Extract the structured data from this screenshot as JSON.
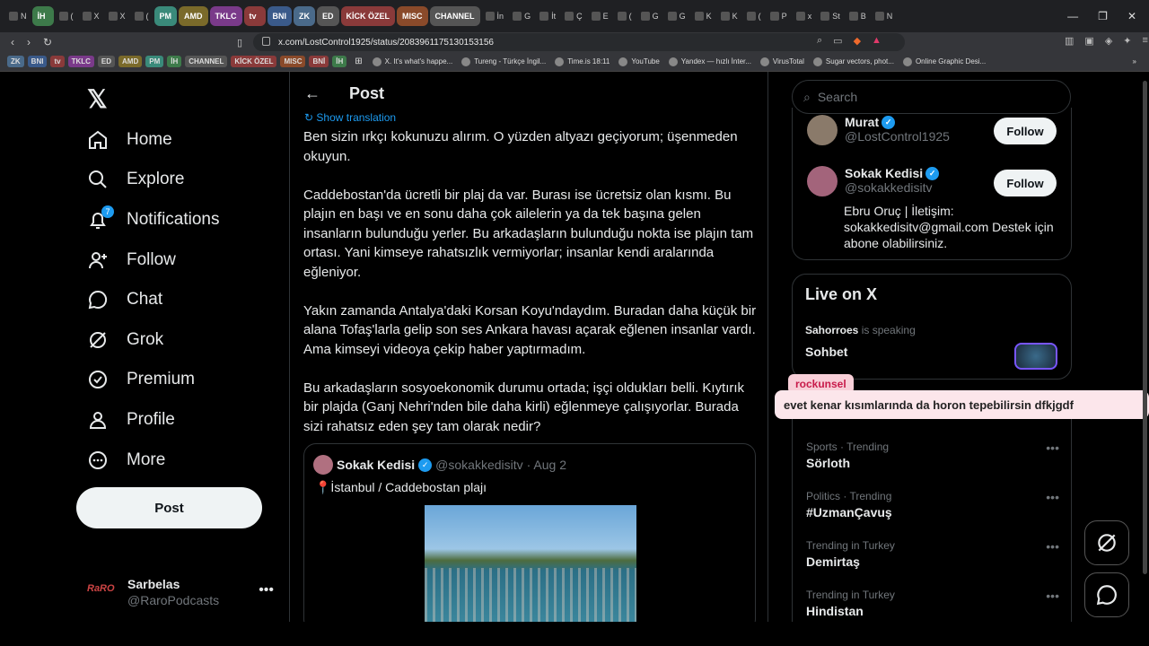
{
  "browser": {
    "tabs": [
      "N",
      "İH",
      "(",
      "X",
      "X",
      "(",
      "PM",
      "AMD",
      "TKLC",
      "tv",
      "BNI",
      "ZK",
      "ED",
      "KİCK ÖZEL",
      "MISC",
      "CHANNEL",
      "İn",
      "G",
      "İt",
      "Ç",
      "E",
      "(",
      "G",
      "G",
      "K",
      "K",
      "(",
      "P",
      "x",
      "St",
      "B",
      "N"
    ],
    "url": "x.com/LostControl1925/status/2083961175130153156",
    "bookmarks": {
      "chips": [
        "ZK",
        "BNI",
        "tv",
        "TKLC",
        "ED",
        "AMD",
        "PM",
        "İH",
        "CHANNEL",
        "KİCK ÖZEL",
        "MISC",
        "BNİ",
        "İH"
      ],
      "links": [
        "X. It's what's happe...",
        "Tureng - Türkçe İngil...",
        "Time.is 18:11",
        "YouTube",
        "Yandex — hızlı İnter...",
        "VirusTotal",
        "Sugar vectors, phot...",
        "Online Graphic Desi..."
      ]
    }
  },
  "nav": {
    "home": "Home",
    "explore": "Explore",
    "notifications": "Notifications",
    "notif_count": "7",
    "follow": "Follow",
    "chat": "Chat",
    "grok": "Grok",
    "premium": "Premium",
    "profile": "Profile",
    "more": "More",
    "post": "Post"
  },
  "me": {
    "name": "Sarbelas",
    "handle": "@RaroPodcasts",
    "avatar_text": "RaRO"
  },
  "main": {
    "title": "Post",
    "show_translation": "Show translation",
    "paragraphs": [
      "Ben sizin ırkçı kokunuzu alırım. O yüzden altyazı geçiyorum; üşenmeden okuyun.",
      "Caddebostan'da ücretli bir plaj da var. Burası ise ücretsiz olan kısmı. Bu plajın en başı ve en sonu daha çok ailelerin ya da tek başına gelen insanların bulunduğu yerler. Bu arkadaşların bulunduğu nokta ise plajın tam ortası. Yani kimseye rahatsızlık vermiyorlar; insanlar kendi aralarında eğleniyor.",
      "Yakın zamanda Antalya'daki Korsan Koyu'ndaydım. Buradan daha küçük bir alana Tofaş'larla gelip son ses Ankara havası açarak eğlenen insanlar vardı. Ama kimseyi videoya çekip haber yaptırmadım.",
      "Bu arkadaşların sosyoekonomik durumu ortada; işçi oldukları belli. Kıytırık bir plajda (Ganj Nehri'nden bile daha kirli) eğlenmeye çalışıyorlar. Burada sizi rahatsız eden şey tam olarak nedir?"
    ],
    "quote": {
      "name": "Sokak Kedisi",
      "handle": "@sokakkedisitv",
      "date": "· Aug 2",
      "text": "📍İstanbul / Caddebostan plajı"
    }
  },
  "sidebar": {
    "search_placeholder": "Search",
    "accounts": [
      {
        "name": "Murat",
        "handle": "@LostControl1925",
        "button": "Follow"
      },
      {
        "name": "Sokak Kedisi",
        "handle": "@sokakkedisitv",
        "button": "Follow",
        "bio": "Ebru Oruç | İletişim: sokakkedisitv@gmail.com Destek için abone olabilirsiniz."
      }
    ],
    "live": {
      "title": "Live on X",
      "speaker": "Sahorroes",
      "speaking": "is speaking",
      "room": "Sohbet"
    },
    "trends": [
      {
        "cat": "Sports · Trending",
        "title": "Sörloth"
      },
      {
        "cat": "Politics · Trending",
        "title": "#UzmanÇavuş"
      },
      {
        "cat": "Trending in Turkey",
        "title": "Demirtaş"
      },
      {
        "cat": "Trending in Turkey",
        "title": "Hindistan"
      }
    ]
  },
  "overlay": {
    "user": "rockunsel",
    "message": "evet kenar kısımlarında da horon tepebilirsin dfkjgdf"
  },
  "colors": {
    "accent": "#1d9bf0",
    "bg": "#000000",
    "border": "#2f3336",
    "muted": "#71767b",
    "chat_label": "#f8cfd8",
    "chat_bubble": "#fce6eb"
  }
}
